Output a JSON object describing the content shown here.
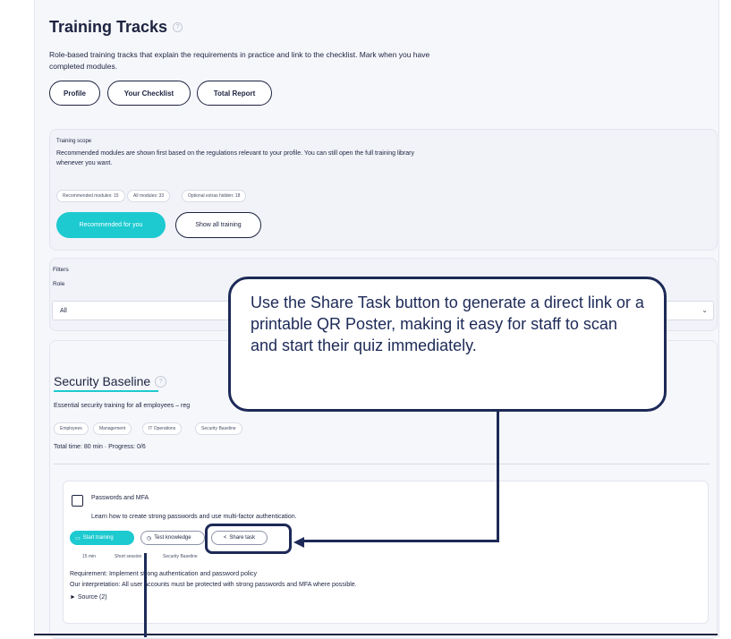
{
  "header": {
    "title": "Training Tracks",
    "help_icon": "?",
    "intro": "Role-based training tracks that explain the requirements in practice and link to the checklist. Mark when you have completed modules."
  },
  "nav_buttons": [
    "Profile",
    "Your Checklist",
    "Total Report"
  ],
  "scope": {
    "label": "Training scope",
    "description": "Recommended modules are shown first based on the regulations relevant to your profile. You can still open the full training library whenever you want.",
    "stats": [
      "Recommended modules: 15",
      "All modules: 33",
      "Optional extras hidden: 18"
    ],
    "recommended_button": "Recommended for you",
    "show_all_button": "Show all training"
  },
  "filters": {
    "label": "Filters",
    "role_label": "Role",
    "role_value": "All"
  },
  "track": {
    "title": "Security Baseline",
    "description": "Essential security training for all employees – reg",
    "tags": [
      "Employees",
      "Management",
      "IT Operations",
      "Security Baseline"
    ],
    "summary": "Total time: 80 min · Progress: 0/6"
  },
  "module": {
    "title": "Passwords and MFA",
    "description": "Learn how to create strong passwords and use multi-factor authentication.",
    "start_button": "Start training",
    "test_button": "Test knowledge",
    "share_button": "Share task",
    "meta": [
      "15 min",
      "Short session",
      "Security Baseline"
    ],
    "requirement": "Requirement: Implement strong authentication and password policy",
    "interpretation": "Our interpretation: All user accounts must be protected with strong passwords and MFA where possible.",
    "source": "► Source (2)"
  },
  "callout": {
    "text": "Use the Share Task button to generate a direct link or a printable QR Poster, making it easy for staff to scan and start their quiz immediately."
  },
  "colors": {
    "accent": "#1ccad0",
    "navy": "#1d2a57"
  }
}
